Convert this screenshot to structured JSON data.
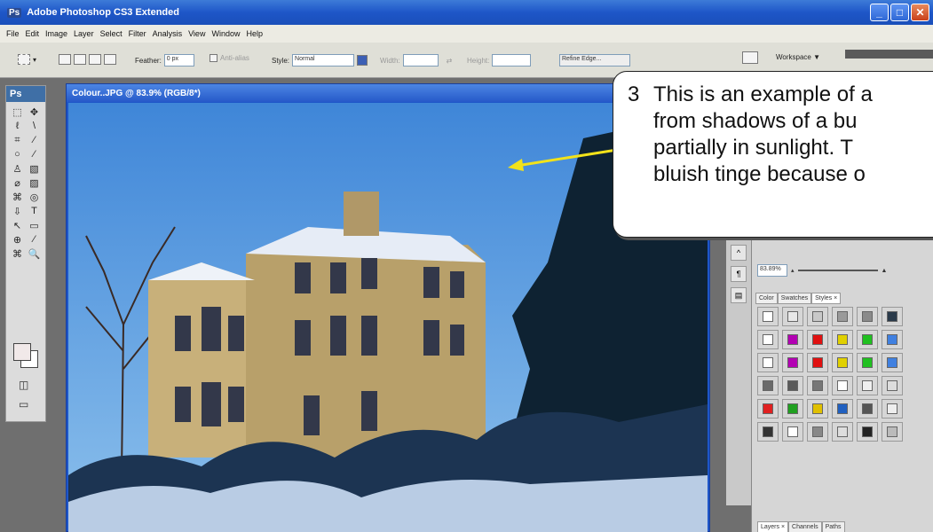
{
  "window": {
    "title": "Adobe Photoshop CS3 Extended",
    "ps_mark": "Ps",
    "minimize": "_",
    "maximize": "□",
    "close": "✕"
  },
  "menu": [
    "File",
    "Edit",
    "Image",
    "Layer",
    "Select",
    "Filter",
    "Analysis",
    "View",
    "Window",
    "Help"
  ],
  "options": {
    "feather_label": "Feather:",
    "feather_value": "0 px",
    "antialias_label": "Anti-alias",
    "style_label": "Style:",
    "style_value": "Normal",
    "width_label": "Width:",
    "height_label": "Height:",
    "refine_edge": "Refine Edge..."
  },
  "workspace": {
    "label": "Workspace ▼"
  },
  "toolbox": {
    "logo": "Ps",
    "tools": [
      "⬚",
      "✥",
      "ℓ",
      "\\",
      "⌗",
      "⁄",
      "○",
      "⁄",
      "♙",
      "▧",
      "⌀",
      "▨",
      "⌘",
      "◎",
      "⇩",
      "T",
      "↖",
      "▭",
      "⊕",
      "⁄",
      "⌘",
      "🔍"
    ]
  },
  "document": {
    "title": "Colour..JPG @ 83.9% (RGB/8*)"
  },
  "panels": {
    "zoom_value": "83.89%",
    "tabs": [
      "Color",
      "Swatches",
      "Styles ×"
    ],
    "layer_tabs": [
      "Layers ×",
      "Channels",
      "Paths"
    ],
    "style_colors": [
      "#ffffff",
      "#e8e8e8",
      "#c8c8c8",
      "#9a9a9a",
      "#8a8a8a",
      "#2a3a4a",
      "#ffffff",
      "#b300b3",
      "#e01010",
      "#e0d000",
      "#20c020",
      "#4080e0",
      "#ffffff",
      "#b300b3",
      "#e01010",
      "#e0d000",
      "#20c020",
      "#4080e0",
      "#6a6a6a",
      "#5a5a5a",
      "#777777",
      "#ffffff",
      "#f0f0f0",
      "#dddddd",
      "#e02020",
      "#20a020",
      "#e0c000",
      "#2060c0",
      "#555555",
      "#eeeeee",
      "#333333",
      "#ffffff",
      "#888888",
      "#dddddd",
      "#222222",
      "#bbbbbb"
    ]
  },
  "callout": {
    "number": "3",
    "lines": [
      "This is an example of a",
      "from shadows of a bu",
      "partially in sunlight.  T",
      "bluish tinge because o"
    ]
  }
}
